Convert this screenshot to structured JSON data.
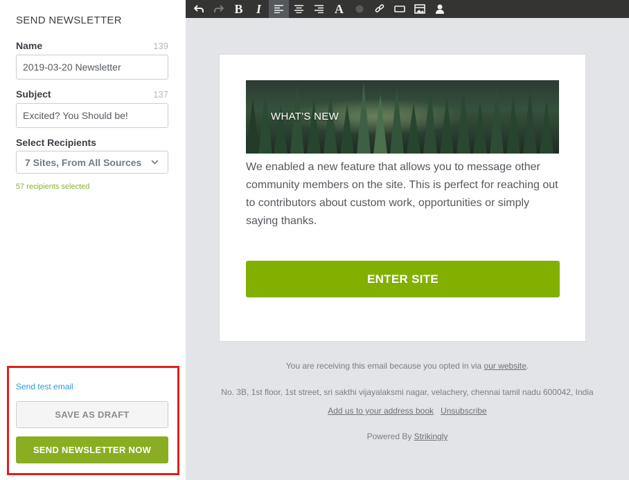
{
  "sidebar": {
    "title": "SEND NEWSLETTER",
    "name": {
      "label": "Name",
      "count": "139",
      "value": "2019-03-20 Newsletter"
    },
    "subject": {
      "label": "Subject",
      "count": "137",
      "value": "Excited? You Should be!"
    },
    "recipients": {
      "label": "Select Recipients",
      "selected": "7 Sites, From All Sources",
      "summary": "57 recipients selected"
    },
    "actions": {
      "test_link": "Send test email",
      "draft_label": "SAVE AS DRAFT",
      "send_label": "SEND NEWSLETTER NOW"
    }
  },
  "toolbar": {
    "buttons": [
      "undo-icon",
      "redo-icon",
      "bold-icon",
      "italic-icon",
      "align-left-icon",
      "align-center-icon",
      "align-right-icon",
      "font-icon",
      "color-icon",
      "link-icon",
      "button-icon",
      "image-icon",
      "user-icon"
    ],
    "labels": {
      "bold": "B",
      "italic": "I",
      "font": "A"
    }
  },
  "email": {
    "hero_text": "WHAT'S NEW",
    "body": "We enabled a new feature that allows you to message other community members on the site. This is perfect for reaching out to contributors about custom work, opportunities or simply saying thanks.",
    "button_label": "ENTER SITE"
  },
  "footer": {
    "opted_in_prefix": "You are receiving this email because you opted in via",
    "opted_in_link": "our website",
    "opted_in_suffix": ".",
    "address": "No. 3B, 1st floor, 1st street, sri sakthi vijayalaksmi nagar, velachery, chennai tamil nadu 600042, India",
    "address_book_link": "Add us to your address book",
    "unsubscribe_link": "Unsubscribe",
    "powered_prefix": "Powered By",
    "powered_link": "Strikingly"
  },
  "colors": {
    "accent_green": "#8aad22",
    "button_green": "#83b000",
    "highlight_red": "#e01e1e",
    "link_blue": "#2e9bd6",
    "toolbar_bg": "#343433",
    "canvas_bg": "#e3e4e8"
  }
}
